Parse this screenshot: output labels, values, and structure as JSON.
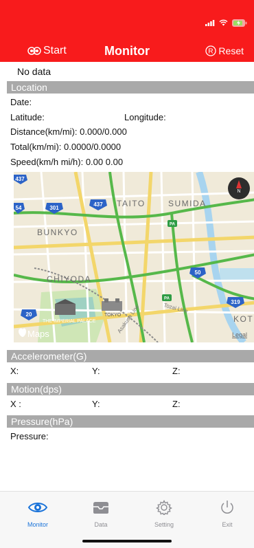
{
  "header": {
    "start_label": "Start",
    "title": "Monitor",
    "reset_label": "Reset",
    "accent_color": "#f81b1c"
  },
  "status_line": "No data",
  "location": {
    "title": "Location",
    "date_label": "Date:",
    "latitude_label": "Latitude:",
    "longitude_label": "Longitude:",
    "distance_label": "Distance(km/mi): ",
    "distance_value": "0.000/0.000",
    "total_label": "Total(km/mi): ",
    "total_value": "0.0000/0.0000",
    "speed_label": "Speed(km/h mi/h): ",
    "speed_value": "0.00 0.00"
  },
  "map": {
    "labels": [
      "TAITO",
      "SUMIDA",
      "BUNKYO",
      "CHIYODA",
      "KOT",
      "THE IMPERIAL PALACE",
      "TOKYO",
      "Tozai Line",
      "Asakusa Line"
    ],
    "route_shields": [
      "437",
      "301",
      "437",
      "50",
      "319",
      "20",
      "54"
    ],
    "pa_badges": [
      "PA",
      "PA"
    ],
    "attribution": "Maps",
    "legal": "Legal",
    "compass_label": "N"
  },
  "accelerometer": {
    "title": "Accelerometer(G)",
    "x_label": "X:",
    "y_label": "Y:",
    "z_label": "Z:"
  },
  "motion": {
    "title": "Motion(dps)",
    "x_label": "X :",
    "y_label": "Y:",
    "z_label": "Z:"
  },
  "pressure": {
    "title": "Pressure(hPa)",
    "pressure_label": "Pressure:"
  },
  "tabs": [
    {
      "label": "Monitor",
      "icon": "eye-icon",
      "active": true
    },
    {
      "label": "Data",
      "icon": "tray-icon",
      "active": false
    },
    {
      "label": "Setting",
      "icon": "gear-icon",
      "active": false
    },
    {
      "label": "Exit",
      "icon": "power-icon",
      "active": false
    }
  ]
}
